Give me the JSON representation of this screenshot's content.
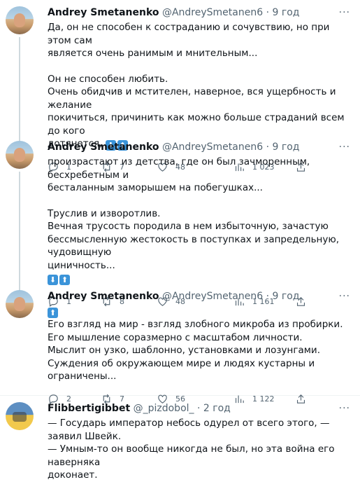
{
  "tweets": [
    {
      "name": "Andrey Smetanenko",
      "handle": "@AndreySmetanen6",
      "time": "9 год",
      "lines": [
        "Да, он не способен к состраданию и сочувствию, но при этом сам",
        "является очень ранимым и мнительным...",
        "",
        "Он не способен любить.",
        "Очень обидчив и мстителен, наверное, вся ущербность и желание",
        "покичиться, причинить как можно больше страданий всем до кого",
        "дотянется,"
      ],
      "emojis": [
        "⬇",
        "⬆"
      ],
      "replies": "1",
      "retweets": "7",
      "likes": "48",
      "views": "1 023"
    },
    {
      "name": "Andrey Smetanenko",
      "handle": "@AndreySmetanen6",
      "time": "9 год",
      "lines": [
        "произрастают из детства, где он был зачморенным, бесхребетным и",
        "бесталанным заморышем на побегушках...",
        "",
        "Труслив и изворотлив.",
        "Вечная трусость породила в нем избыточную, зачастую",
        "бессмысленную жестокость в поступках и запредельную, чудовищную",
        "циничность..."
      ],
      "emojis": [
        "⬇",
        "⬆"
      ],
      "replies": "1",
      "retweets": "8",
      "likes": "48",
      "views": "1 161"
    },
    {
      "name": "Andrey Smetanenko",
      "handle": "@AndreySmetanen6",
      "time": "9 год",
      "lead_emoji": "⬆",
      "lines": [
        "Его взгляд на мир - взгляд злобного микроба из пробирки.",
        "Его мышление соразмерно с масштабом личности.",
        "Мыслит он узко, шаблонно, установками и  лозунгами.",
        "Суждения об окружающем мире и людях кустарны и ограничены..."
      ],
      "replies": "2",
      "retweets": "7",
      "likes": "56",
      "views": "1 122"
    },
    {
      "name": "Flibbertigibbet",
      "handle": "@_pizdobol_",
      "time": "2 год",
      "lines": [
        "— Государь император небось одурел от всего этого, — заявил Швейк.",
        "— Умным-то он вообще никогда не был, но эта война его наверняка",
        "доконает."
      ]
    }
  ],
  "ui": {
    "dot": "·",
    "more": "···"
  }
}
